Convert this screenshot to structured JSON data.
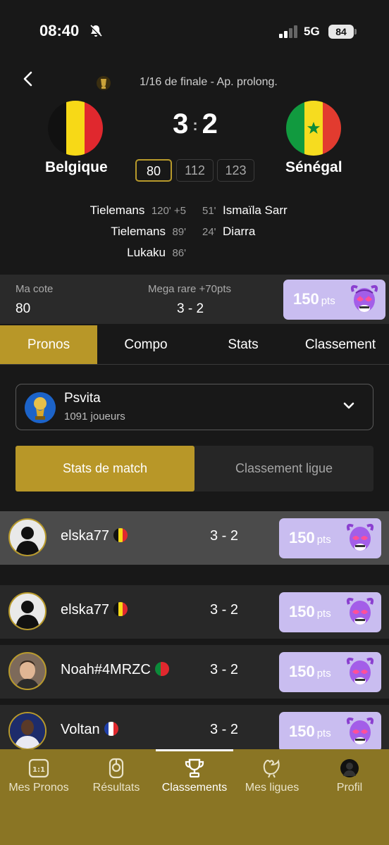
{
  "status_bar": {
    "time": "08:40",
    "network": "5G",
    "battery": "84"
  },
  "match": {
    "round": "1/16 de finale  -  Ap. prolong.",
    "home_team": "Belgique",
    "away_team": "Sénégal",
    "home_score": "3",
    "away_score": "2",
    "odds": [
      "80",
      "112",
      "123"
    ],
    "home_scorers": [
      {
        "name": "Tielemans",
        "minute": "120' +5"
      },
      {
        "name": "Tielemans",
        "minute": "89'"
      },
      {
        "name": "Lukaku",
        "minute": "86'"
      }
    ],
    "away_scorers": [
      {
        "minute": "51'",
        "name": "Ismaïla Sarr"
      },
      {
        "minute": "24'",
        "name": "Diarra"
      }
    ]
  },
  "cote": {
    "label": "Ma cote",
    "value": "80",
    "rarity": "Mega rare +70pts",
    "prediction": "3 - 2",
    "points": "150",
    "points_unit": "pts"
  },
  "tabs": [
    "Pronos",
    "Compo",
    "Stats",
    "Classement"
  ],
  "league": {
    "name": "Psvita",
    "players": "1091 joueurs"
  },
  "segments": [
    "Stats de match",
    "Classement ligue"
  ],
  "rows": [
    {
      "user": "elska77",
      "flag": "belgium",
      "score": "3 - 2",
      "points": "150",
      "unit": "pts"
    },
    {
      "user": "elska77",
      "flag": "belgium",
      "score": "3 - 2",
      "points": "150",
      "unit": "pts"
    },
    {
      "user": "Noah#4MRZC",
      "flag": "portugal",
      "score": "3 - 2",
      "points": "150",
      "unit": "pts"
    },
    {
      "user": "Voltan",
      "flag": "france",
      "score": "3 - 2",
      "points": "150",
      "unit": "pts"
    }
  ],
  "nav": [
    "Mes Pronos",
    "Résultats",
    "Classements",
    "Mes ligues",
    "Profil"
  ],
  "colors": {
    "accent": "#b89728",
    "points_bg": "#c9bdf0",
    "nav_bg": "#8a7524"
  }
}
